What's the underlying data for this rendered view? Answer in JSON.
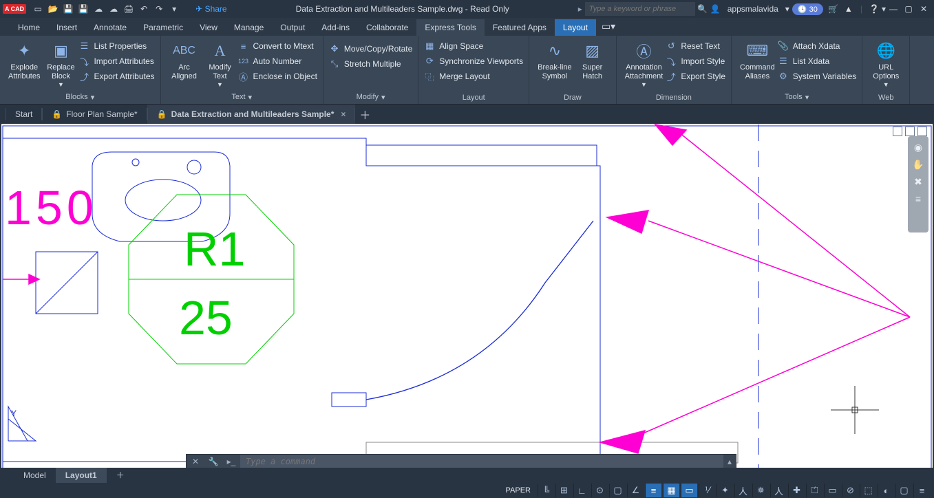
{
  "title": "Data Extraction and Multileaders Sample.dwg - Read Only",
  "share": "Share",
  "search_ph": "Type a keyword or phrase",
  "user": "appsmalavida",
  "trial": "30",
  "menutabs": [
    "Home",
    "Insert",
    "Annotate",
    "Parametric",
    "View",
    "Manage",
    "Output",
    "Add-ins",
    "Collaborate",
    "Express Tools",
    "Featured Apps",
    "Layout"
  ],
  "menutab_on_dark": "Express Tools",
  "menutab_on_blue": "Layout",
  "ribbon": {
    "blocks": {
      "label": "Blocks",
      "explode": "Explode\nAttributes",
      "replace": "Replace\nBlock",
      "items": [
        "List Properties",
        "Import Attributes",
        "Export Attributes"
      ]
    },
    "text": {
      "label": "Text",
      "arc": "Arc\nAligned",
      "modify": "Modify\nText",
      "items": [
        "Convert to Mtext",
        "Auto Number",
        "Enclose in Object"
      ]
    },
    "modify": {
      "label": "Modify",
      "items": [
        "Move/Copy/Rotate",
        "Stretch Multiple"
      ]
    },
    "layout": {
      "label": "Layout",
      "items": [
        "Align Space",
        "Synchronize Viewports",
        "Merge Layout"
      ]
    },
    "draw": {
      "label": "Draw",
      "brk": "Break-line\nSymbol",
      "hatch": "Super\nHatch"
    },
    "dim": {
      "label": "Dimension",
      "ann": "Annotation\nAttachment",
      "items": [
        "Reset Text",
        "Import Style",
        "Export Style"
      ]
    },
    "tools": {
      "label": "Tools",
      "cmd": "Command\nAliases",
      "items": [
        "Attach Xdata",
        "List Xdata",
        "System Variables"
      ]
    },
    "web": {
      "label": "Web",
      "url": "URL\nOptions"
    }
  },
  "doctabs": {
    "start": "Start",
    "fp": "Floor Plan Sample*",
    "de": "Data Extraction and Multileaders Sample*"
  },
  "drawing": {
    "dim": "150",
    "r1": "R1",
    "r2": "25"
  },
  "cmd_ph": "Type a command",
  "laytabs": {
    "model": "Model",
    "l1": "Layout1"
  },
  "status": {
    "paper": "PAPER"
  }
}
